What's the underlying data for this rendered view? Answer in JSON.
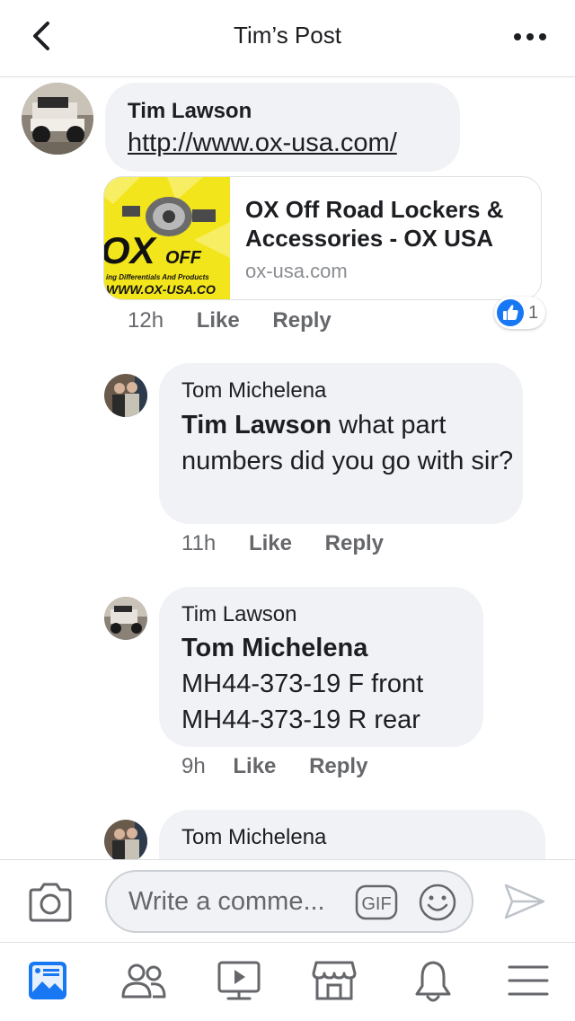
{
  "header": {
    "title": "Tim’s Post",
    "back_icon": "chevron-left-icon",
    "more_icon": "more-dots-icon"
  },
  "comments": [
    {
      "author": "Tim Lawson",
      "link": "http://www.ox-usa.com/",
      "preview": {
        "title": "OX Off Road Lockers & Accessories - OX USA",
        "domain": "ox-usa.com",
        "image_text_big": "OX",
        "image_text_small": "OFF",
        "image_tagline": "ing Differentials And Products",
        "image_url_text": "WWW.OX-USA.CO"
      },
      "time": "12h",
      "like": "Like",
      "reply": "Reply",
      "reaction_count": "1"
    },
    {
      "author": "Tom Michelena",
      "mention": "Tim Lawson",
      "text": " what part numbers did you go with sir?",
      "time": "11h",
      "like": "Like",
      "reply": "Reply"
    },
    {
      "author": "Tim Lawson",
      "mention": "Tom Michelena",
      "line1": "MH44-373-19 F front",
      "line2": "MH44-373-19 R rear",
      "time": "9h",
      "like": "Like",
      "reply": "Reply"
    },
    {
      "author": "Tom Michelena"
    }
  ],
  "composer": {
    "placeholder": "Write a comme...",
    "gif_label": "GIF"
  },
  "colors": {
    "accent": "#1877f2",
    "bubble": "#f0f2f5",
    "meta": "#65676b",
    "icon": "#65676b"
  },
  "nav": [
    "news-feed-icon",
    "friends-icon",
    "watch-icon",
    "marketplace-icon",
    "notifications-icon",
    "menu-icon"
  ]
}
